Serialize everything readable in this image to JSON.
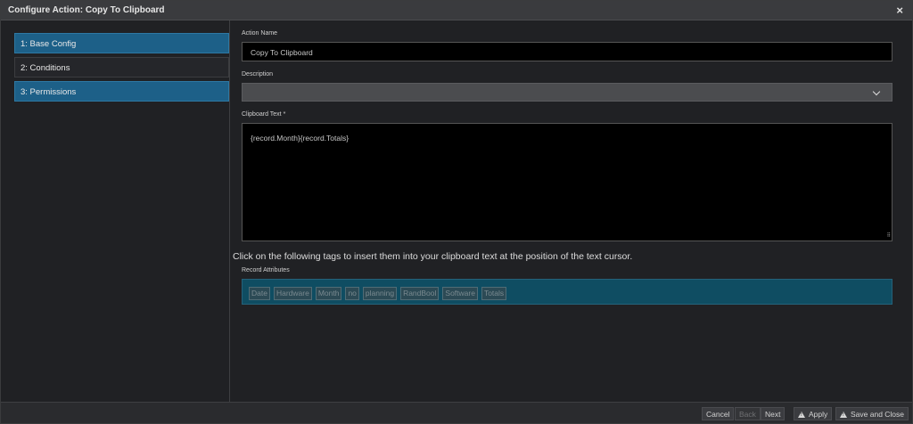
{
  "dialog": {
    "title": "Configure Action: Copy To Clipboard",
    "close_glyph": "×"
  },
  "nav": {
    "items": [
      {
        "label": "1: Base Config"
      },
      {
        "label": "2: Conditions"
      },
      {
        "label": "3: Permissions"
      }
    ]
  },
  "form": {
    "action_name_label": "Action Name",
    "action_name_value": "Copy To Clipboard",
    "description_label": "Description",
    "description_value": "",
    "clipboard_label": "Clipboard Text *",
    "clipboard_value": "{record.Month}{record.Totals}",
    "hint": "Click on the following tags to insert them into your clipboard text at the position of the text cursor.",
    "attributes_label": "Record Attributes",
    "tags": [
      "Date",
      "Hardware",
      "Month",
      "no",
      "planning",
      "RandBool",
      "Software",
      "Totals"
    ]
  },
  "footer": {
    "cancel": "Cancel",
    "back": "Back",
    "next": "Next",
    "apply": "Apply",
    "save_close": "Save and Close"
  }
}
